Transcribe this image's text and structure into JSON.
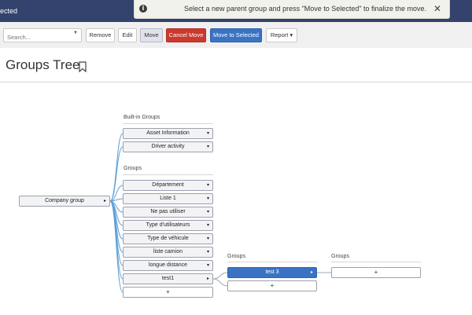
{
  "topbar": {
    "title": "ected"
  },
  "notice": {
    "icon": "info-icon",
    "text": "Select a new parent group and press \"Move to Selected\" to finalize the move.",
    "close": "✕"
  },
  "toolbar": {
    "search_placeholder": "Search...",
    "search_caret": "▼",
    "remove": "Remove",
    "edit": "Edit",
    "move": "Move",
    "cancel_move": "Cancel Move",
    "move_to_selected": "Move to Selected",
    "report": "Report ▾"
  },
  "page": {
    "title": "Groups Tree",
    "bookmark_icon": "bookmark-icon"
  },
  "tree": {
    "root": "Company group",
    "root_arrow": "▸",
    "builtin_label": "Built-in Groups",
    "builtin": [
      "Asset Information",
      "Driver activity"
    ],
    "groups_label": "Groups",
    "groups": [
      "Département",
      "Liste 1",
      "Ne pas utiliser",
      "Type d'utilisateurs",
      "Type de véhicule",
      "liste camion",
      "longue distance",
      "test1"
    ],
    "dropdown_glyph": "▾",
    "child_arrow": "▸",
    "add": "+",
    "level2_label": "Groups",
    "level2_selected": "test 3",
    "level2_add": "+",
    "level3_label": "Groups",
    "level3_add": "+"
  },
  "colors": {
    "topbar": "#33436e",
    "primary": "#3a73c4",
    "danger": "#c9392d",
    "connector": "#5a9fd4"
  }
}
